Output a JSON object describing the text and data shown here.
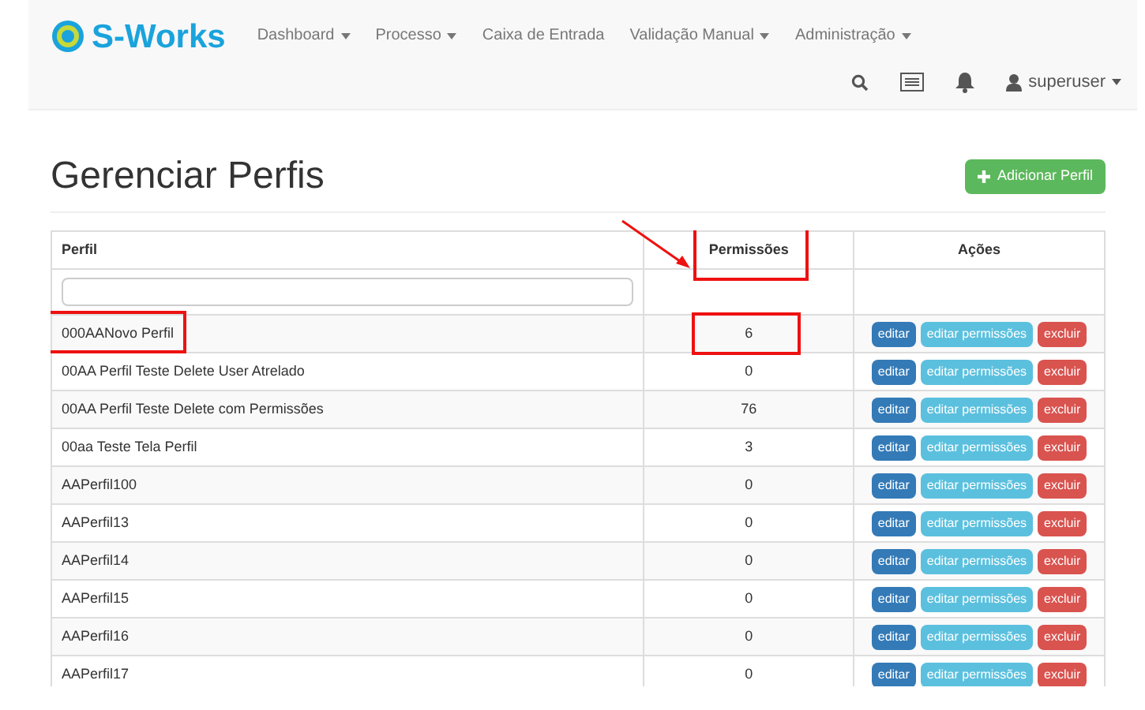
{
  "navbar": {
    "brand": "S-Works",
    "menu": [
      {
        "label": "Dashboard",
        "dropdown": true
      },
      {
        "label": "Processo",
        "dropdown": true
      },
      {
        "label": "Caixa de Entrada",
        "dropdown": false
      },
      {
        "label": "Validação Manual",
        "dropdown": true
      },
      {
        "label": "Administração",
        "dropdown": true
      }
    ],
    "user": "superuser"
  },
  "page_title": "Gerenciar Perfis",
  "add_button": "Adicionar Perfil",
  "table": {
    "columns": [
      {
        "label": "Perfil",
        "highlighted": false
      },
      {
        "label": "Permissões",
        "highlighted": true
      },
      {
        "label": "Ações",
        "highlighted": false
      }
    ],
    "rows": [
      {
        "perfil": "000AANovo Perfil",
        "permissoes": "6",
        "highlighted": true,
        "actions": [
          "editar",
          "editar permissões",
          "excluir"
        ]
      },
      {
        "perfil": "00AA Perfil Teste Delete User Atrelado",
        "permissoes": "0",
        "highlighted": false,
        "actions": [
          "editar",
          "editar permissões",
          "excluir"
        ]
      },
      {
        "perfil": "00AA Perfil Teste Delete com Permissões",
        "permissoes": "76",
        "highlighted": false,
        "actions": [
          "editar",
          "editar permissões",
          "excluir"
        ]
      },
      {
        "perfil": "00aa Teste Tela Perfil",
        "permissoes": "3",
        "highlighted": false,
        "actions": [
          "editar",
          "editar permissões",
          "excluir"
        ]
      },
      {
        "perfil": "AAPerfil100",
        "permissoes": "0",
        "highlighted": false,
        "actions": [
          "editar",
          "editar permissões",
          "excluir"
        ]
      },
      {
        "perfil": "AAPerfil13",
        "permissoes": "0",
        "highlighted": false,
        "actions": [
          "editar",
          "editar permissões",
          "excluir"
        ]
      },
      {
        "perfil": "AAPerfil14",
        "permissoes": "0",
        "highlighted": false,
        "actions": [
          "editar",
          "editar permissões",
          "excluir"
        ]
      },
      {
        "perfil": "AAPerfil15",
        "permissoes": "0",
        "highlighted": false,
        "actions": [
          "editar",
          "editar permissões",
          "excluir"
        ]
      },
      {
        "perfil": "AAPerfil16",
        "permissoes": "0",
        "highlighted": false,
        "actions": [
          "editar",
          "editar permissões",
          "excluir"
        ]
      },
      {
        "perfil": "AAPerfil17",
        "permissoes": "0",
        "highlighted": false,
        "actions": [
          "editar",
          "editar permissões",
          "excluir"
        ]
      }
    ]
  }
}
